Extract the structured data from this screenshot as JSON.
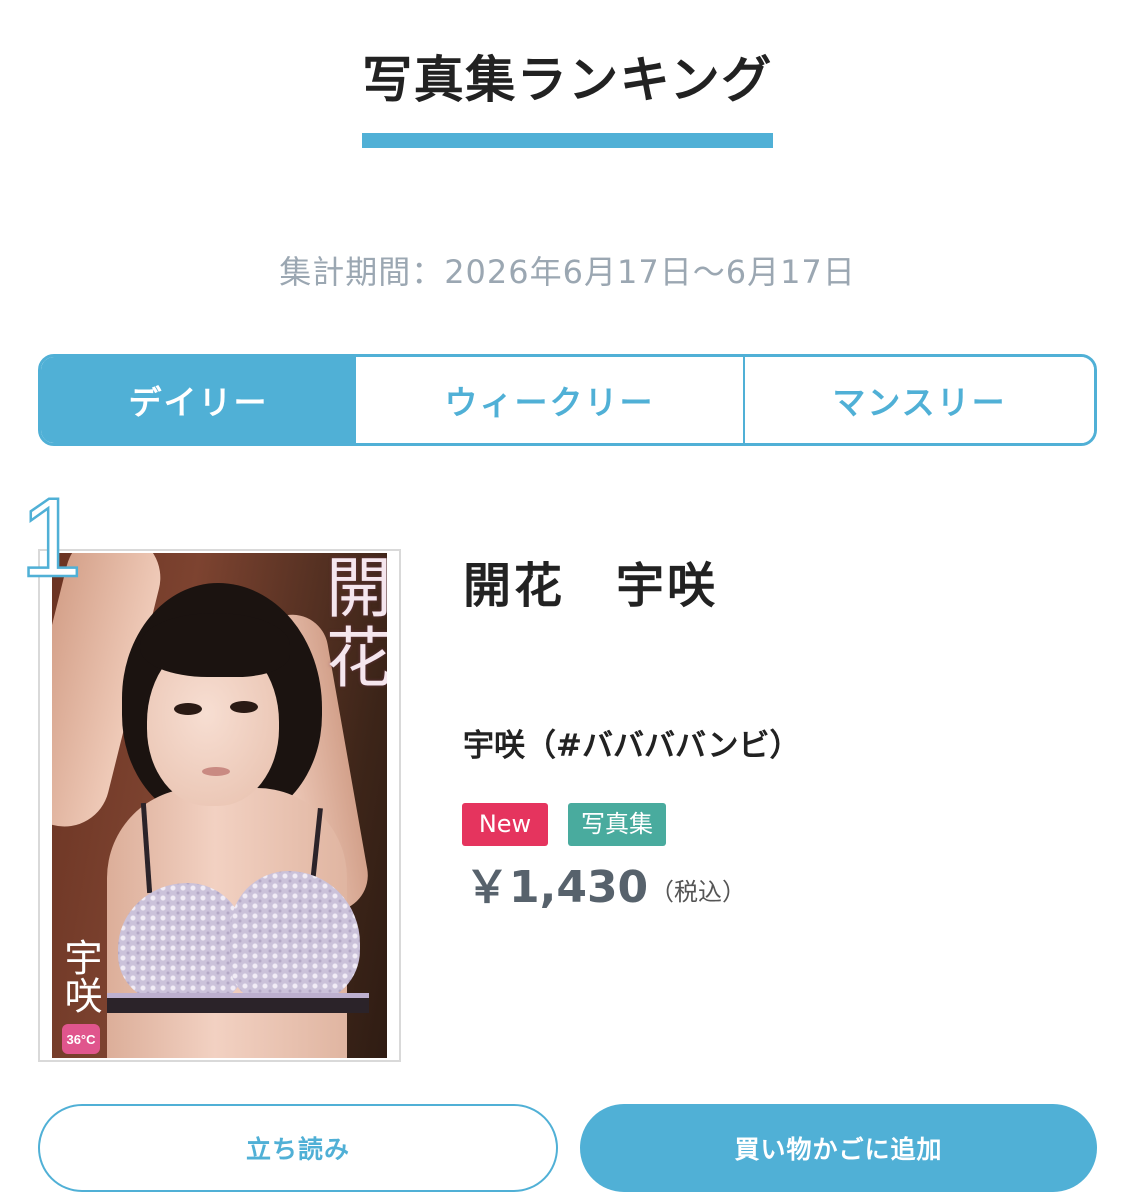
{
  "colors": {
    "accent": "#50b0d6",
    "title_text": "#222222",
    "muted_text": "#9ba7b2",
    "badge_new": "#e5345e",
    "badge_category": "#49ab9e",
    "price_text": "#57626c",
    "tax_text": "#555555"
  },
  "page": {
    "title": "写真集ランキング",
    "period": "集計期間：2026年6月17日〜6月17日"
  },
  "tabs": [
    {
      "label": "デイリー",
      "active": true
    },
    {
      "label": "ウィークリー",
      "active": false
    },
    {
      "label": "マンスリー",
      "active": false
    }
  ],
  "ranking": [
    {
      "rank": "1",
      "title": "開花　宇咲",
      "author": "宇咲（#ババババンビ）",
      "badges": [
        "New",
        "写真集"
      ],
      "price": "￥1,430",
      "tax_note": "（税込）",
      "cover": {
        "title_text": "開花",
        "name_text": "宇咲",
        "logo": "36°C"
      },
      "actions": {
        "preview_label": "立ち読み",
        "cart_label": "買い物かごに追加"
      }
    }
  ]
}
